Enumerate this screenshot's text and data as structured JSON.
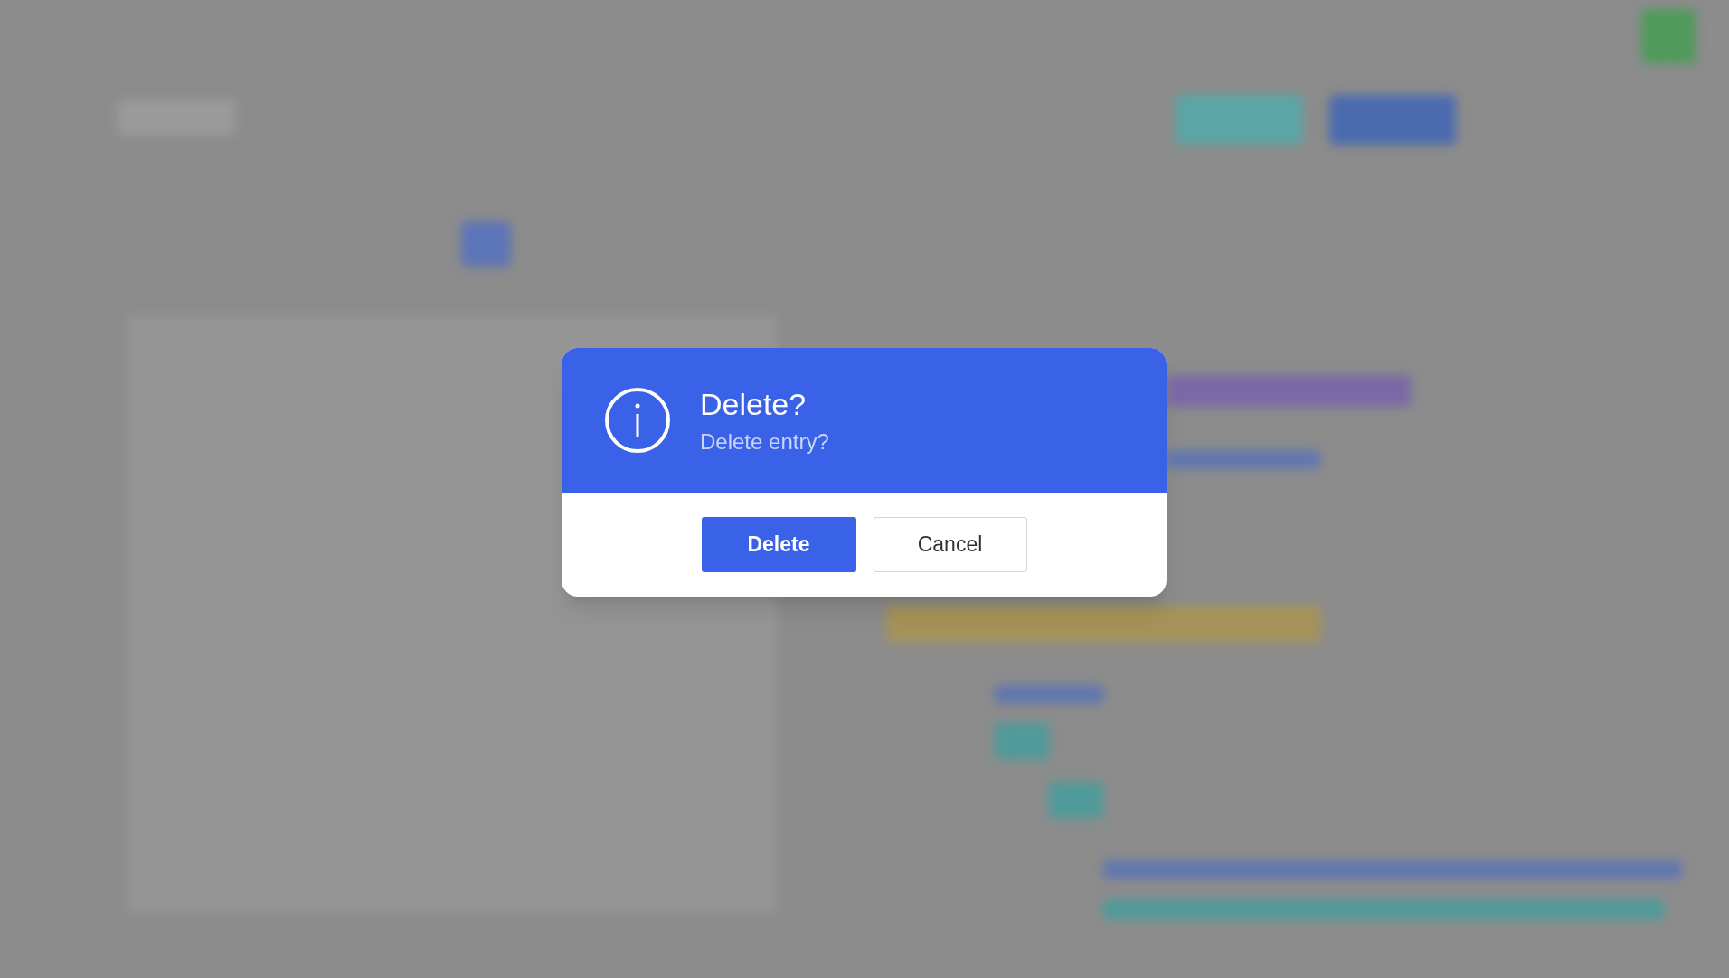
{
  "dialog": {
    "title": "Delete?",
    "message": "Delete entry?",
    "buttons": [
      {
        "label": "Delete",
        "kind": "primary"
      },
      {
        "label": "Cancel",
        "kind": "secondary"
      }
    ]
  }
}
